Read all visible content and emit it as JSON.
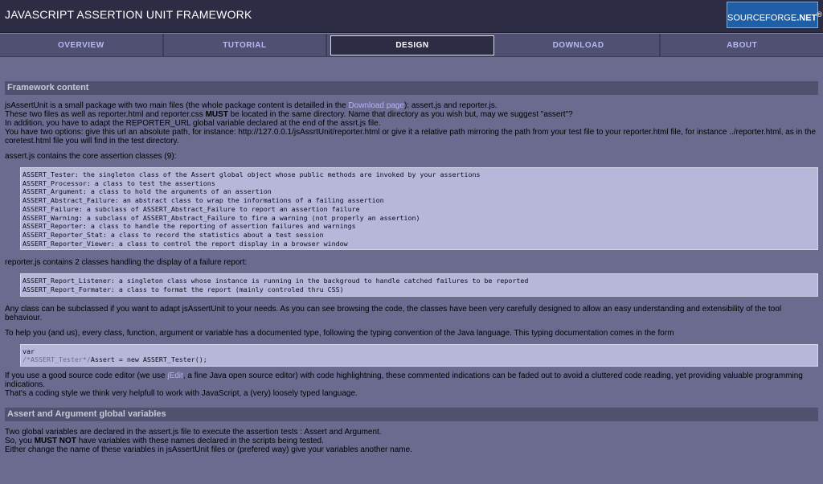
{
  "header": {
    "title": "JAVASCRIPT ASSERTION UNIT FRAMEWORK",
    "logo_text_main": "SOURCEFORGE",
    "logo_text_suffix": ".NET",
    "logo_sup": "®"
  },
  "nav": {
    "items": [
      {
        "label": "OVERVIEW"
      },
      {
        "label": "TUTORIAL"
      },
      {
        "label": "DESIGN"
      },
      {
        "label": "DOWNLOAD"
      },
      {
        "label": "ABOUT"
      }
    ],
    "active": "DESIGN"
  },
  "sections": {
    "framework": {
      "title": "Framework content",
      "intro_pre": "jsAssertUnit is a small package with two main files (the whole package content is detailled in the ",
      "intro_link": "Download page",
      "intro_post": "): assert.js and reporter.js.",
      "line2_pre": "These two files as well as reporter.html and reporter.css ",
      "line2_bold": "MUST",
      "line2_post": " be located in the same directory. Name that directory as you wish but, may we suggest \"assert\"?",
      "line3": "In addition, you have to adapt the REPORTER_URL global variable declared at the end of the assrt.js file.",
      "line4": "You have two options: give this url an absolute path, for instance: http://127.0.0.1/jsAssrtUnit/reporter.html or give it a relative path mirroring the path from your test file to your reporter.html file, for instance ../reporter.html, as in the coretest.html file you will find in the test directory.",
      "assert_intro": "assert.js contains the core assertion classes (9):",
      "assert_classes": [
        "ASSERT_Tester: the singleton class of the Assert global object whose public methods are invoked by your assertions",
        "ASSERT_Processor: a class to test the assertions",
        "ASSERT_Argument: a class to hold the arguments of an assertion",
        "ASSERT_Abstract_Failure: an abstract class to wrap the informations of a failing assertion",
        "ASSERT_Failure: a subclass of ASSERT_Abstract_Failure to report an assertion failure",
        "ASSERT_Warning: a subclass of ASSERT_Abstract_Failure to fire a warning (not properly an assertion)",
        "ASSERT_Reporter: a class to handle the reporting of assertion failures and warnings",
        "ASSERT_Reporter_Stat: a class to record the statistics about a test session",
        "ASSERT_Reporter_Viewer: a class to control the report display in a browser window"
      ],
      "reporter_intro": "reporter.js contains 2 classes handling the display of a failure report:",
      "reporter_classes": [
        "ASSERT_Report_Listener: a singleton class whose instance is running in the backgroud to handle catched failures to be reported",
        "ASSERT_Report_Formater: a class to format the report (mainly controled thru CSS)"
      ],
      "subclass_text": "Any class can be subclassed if you want to adapt jsAssertUnit to your needs. As you can see browsing the code, the classes have been very carefully designed to allow an easy understanding and extensibility of the tool behaviour.",
      "typing_text": "To help you (and us), every class, function, argument or variable has a documented type, following the typing convention of the Java language. This typing documentation comes in the form",
      "code_line1": "var",
      "code_comment": "/*ASSERT_Tester*/",
      "code_rest": "Assert = new ASSERT_Tester();",
      "editor_pre": "If you use a good source code editor (we use ",
      "editor_link": "jEdit",
      "editor_post": ", a fine Java open source editor) with code highlightning, these commented indications can be faded out to avoid a cluttered code reading, yet providing valuable programming indications.",
      "coding_style": "That's a coding style we think very helpfull to work with JavaScript, a (very) loosely typed language."
    },
    "globals": {
      "title": "Assert and Argument global variables",
      "line1": "Two global variables are declared in the assert.js file to execute the assertion tests : Assert and Argument.",
      "line2_pre": "So, you ",
      "line2_bold": "MUST NOT",
      "line2_post": " have variables with these names declared in the scripts being tested.",
      "line3": "Either change the name of these variables in jsAssertUnit files or (prefered way) give your variables another name."
    }
  }
}
